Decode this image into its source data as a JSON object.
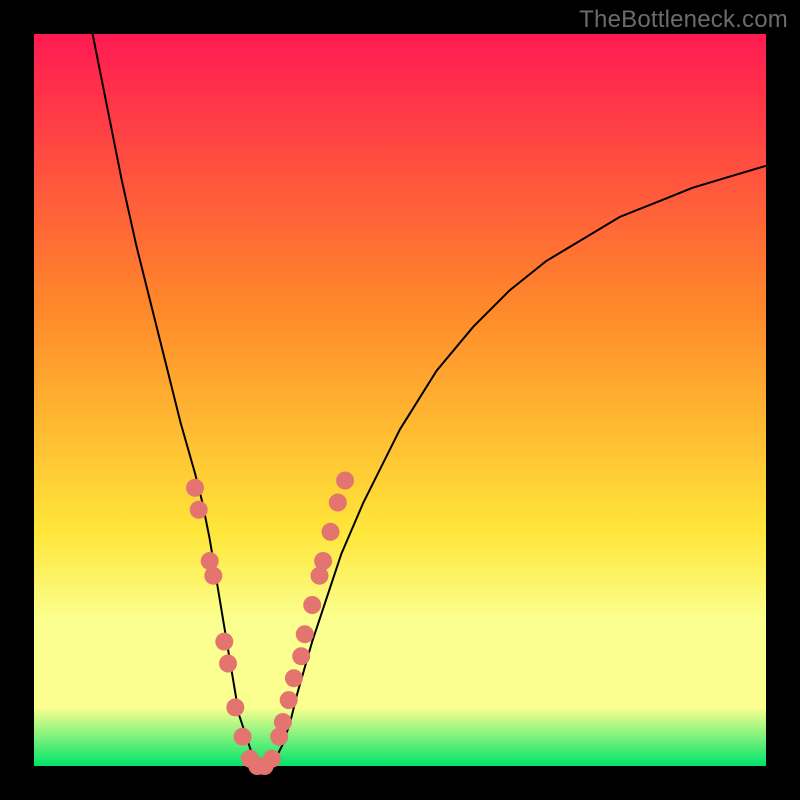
{
  "watermark": "TheBottleneck.com",
  "colors": {
    "frame": "#000000",
    "grad_top": "#ff1a52",
    "grad_mid1": "#ff8a2a",
    "grad_mid2": "#ffe63a",
    "grad_band": "#fbff8f",
    "grad_bottom": "#00e46a",
    "curve": "#000000",
    "dot": "#e4746f"
  },
  "chart_data": {
    "type": "line",
    "title": "",
    "xlabel": "",
    "ylabel": "",
    "xlim": [
      0,
      100
    ],
    "ylim": [
      0,
      100
    ],
    "grid": false,
    "legend": false,
    "series": [
      {
        "name": "bottleneck-curve",
        "x": [
          8,
          10,
          12,
          14,
          16,
          18,
          20,
          22,
          23,
          24,
          25,
          26,
          27,
          28,
          29,
          30,
          31,
          32,
          33,
          34,
          35,
          36,
          38,
          40,
          42,
          45,
          50,
          55,
          60,
          65,
          70,
          75,
          80,
          85,
          90,
          95,
          100
        ],
        "y": [
          100,
          90,
          80,
          71,
          63,
          55,
          47,
          40,
          36,
          31,
          25,
          19,
          13,
          7,
          4,
          1,
          0,
          0,
          1,
          3,
          6,
          10,
          17,
          23,
          29,
          36,
          46,
          54,
          60,
          65,
          69,
          72,
          75,
          77,
          79,
          80.5,
          82
        ]
      }
    ],
    "marker_clusters": [
      {
        "name": "left-arm-dots",
        "points": [
          {
            "x": 22.0,
            "y": 38
          },
          {
            "x": 22.5,
            "y": 35
          },
          {
            "x": 24.0,
            "y": 28
          },
          {
            "x": 24.5,
            "y": 26
          },
          {
            "x": 26.0,
            "y": 17
          },
          {
            "x": 26.5,
            "y": 14
          },
          {
            "x": 27.5,
            "y": 8
          },
          {
            "x": 28.5,
            "y": 4
          }
        ]
      },
      {
        "name": "trough-dots",
        "points": [
          {
            "x": 29.5,
            "y": 1
          },
          {
            "x": 30.5,
            "y": 0
          },
          {
            "x": 31.5,
            "y": 0
          },
          {
            "x": 32.5,
            "y": 1
          }
        ]
      },
      {
        "name": "right-arm-dots",
        "points": [
          {
            "x": 33.5,
            "y": 4
          },
          {
            "x": 34.0,
            "y": 6
          },
          {
            "x": 34.8,
            "y": 9
          },
          {
            "x": 35.5,
            "y": 12
          },
          {
            "x": 36.5,
            "y": 15
          },
          {
            "x": 37.0,
            "y": 18
          },
          {
            "x": 38.0,
            "y": 22
          },
          {
            "x": 39.0,
            "y": 26
          },
          {
            "x": 39.5,
            "y": 28
          },
          {
            "x": 40.5,
            "y": 32
          },
          {
            "x": 41.5,
            "y": 36
          },
          {
            "x": 42.5,
            "y": 39
          }
        ]
      }
    ]
  }
}
